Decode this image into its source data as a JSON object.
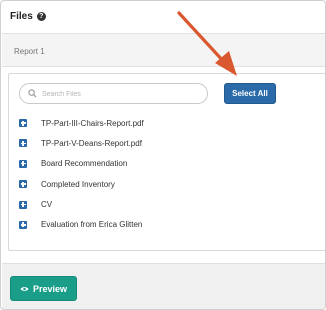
{
  "header": {
    "title": "Files",
    "help_icon": "?"
  },
  "report": {
    "label": "Report 1"
  },
  "search": {
    "placeholder": "Search Files",
    "value": ""
  },
  "select_all": {
    "label": "Select All"
  },
  "files": [
    {
      "name": "TP-Part-III-Chairs-Report.pdf"
    },
    {
      "name": "TP-Part-V-Deans-Report.pdf"
    },
    {
      "name": "Board Recommendation"
    },
    {
      "name": "Completed Inventory"
    },
    {
      "name": "CV"
    },
    {
      "name": "Evaluation from Erica Glitten"
    }
  ],
  "footer": {
    "preview_label": "Preview"
  },
  "colors": {
    "primary_blue": "#2a6aa8",
    "preview_teal": "#1a9e89",
    "arrow_orange": "#d9582f"
  },
  "icons": [
    "help-icon",
    "search-icon",
    "plus-icon",
    "eye-icon",
    "arrow-annotation"
  ]
}
